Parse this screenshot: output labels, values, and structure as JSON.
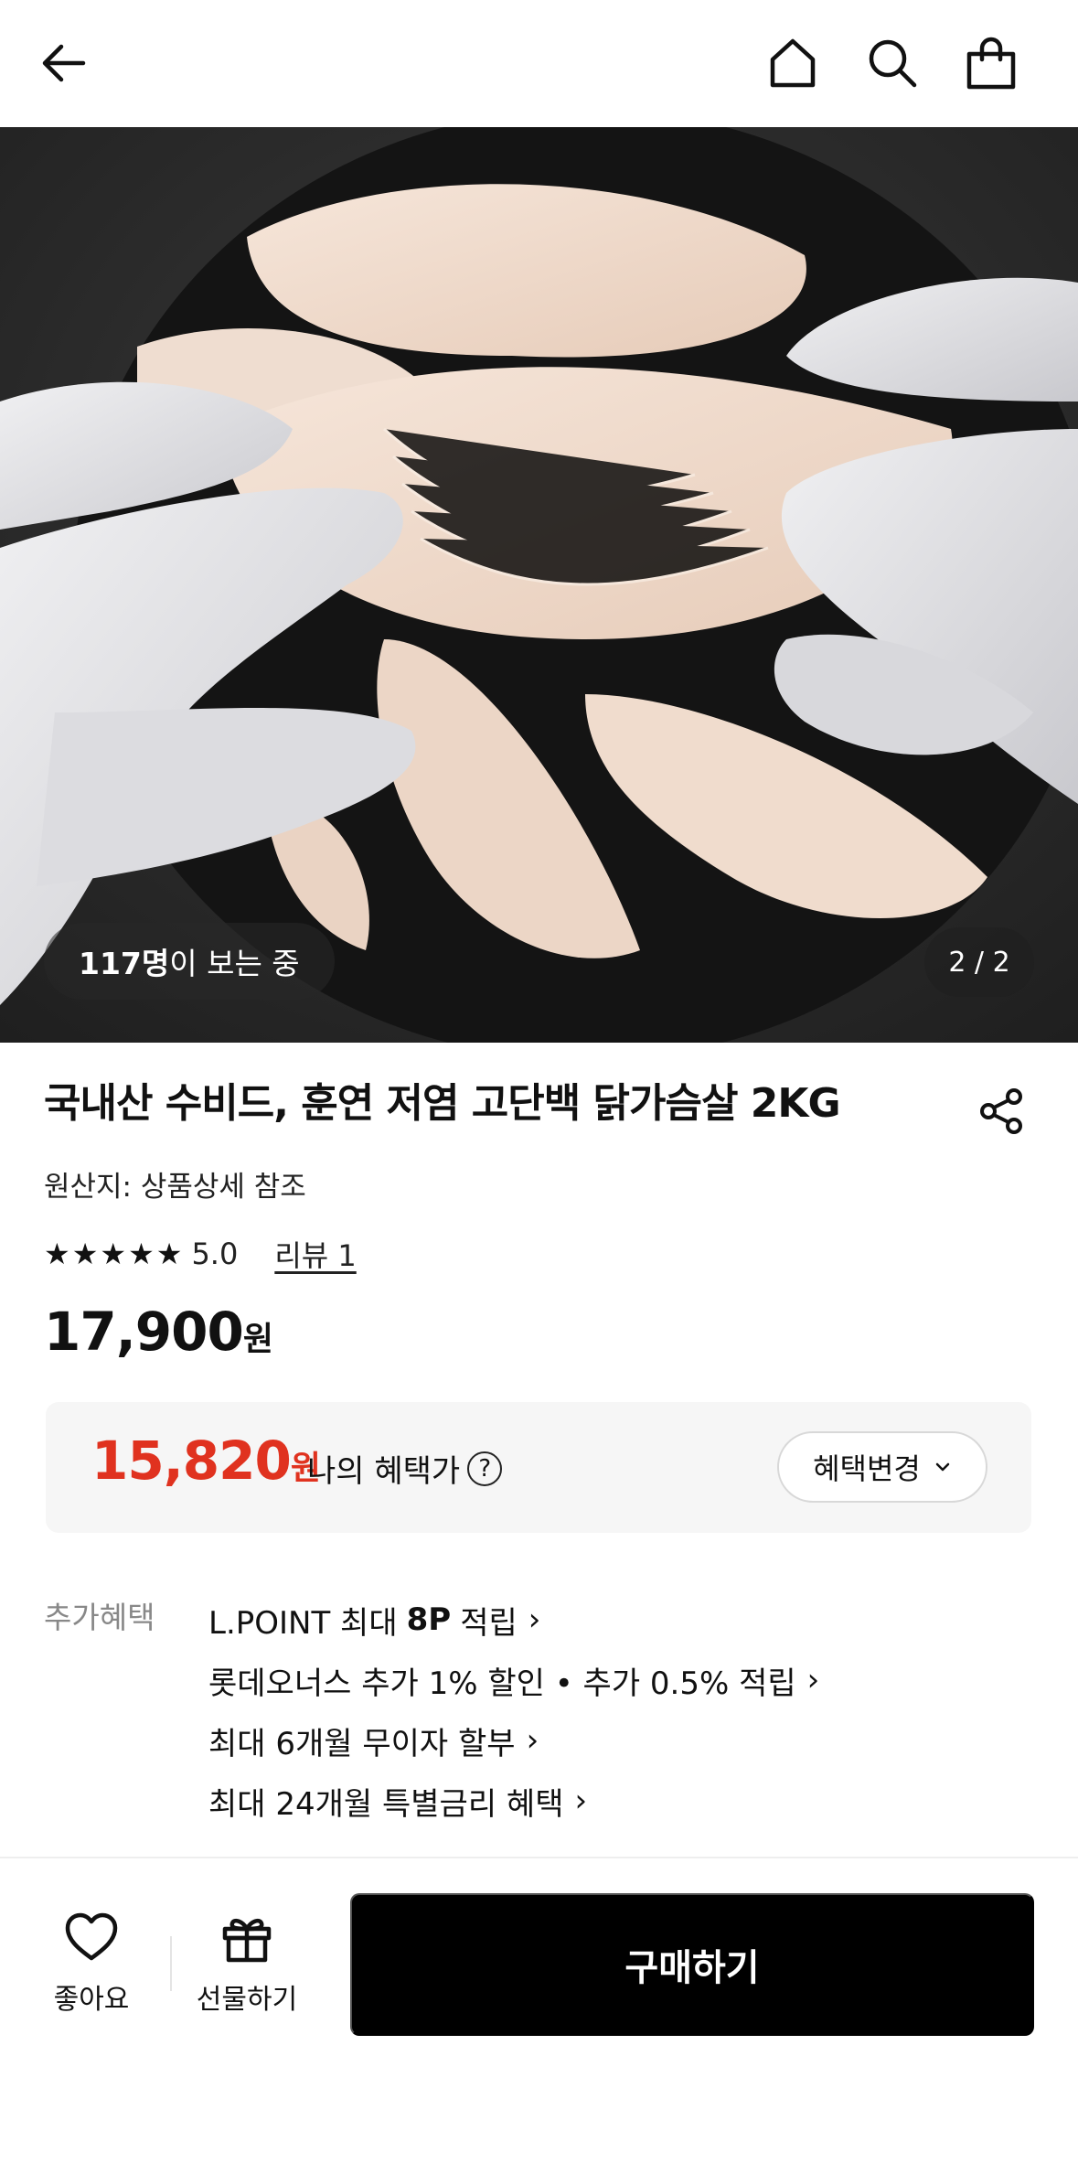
{
  "header": {
    "back_icon": "arrow-left-icon",
    "home_icon": "home-icon",
    "search_icon": "search-icon",
    "cart_icon": "shopping-bag-icon"
  },
  "hero": {
    "viewers_count": "117명",
    "viewers_suffix": "이 보는 중",
    "pager": "2 / 2"
  },
  "product": {
    "title": "국내산 수비드, 훈연 저염 고단백 닭가슴살 2KG",
    "origin": "원산지: 상품상세 참조",
    "rating": 5.0,
    "rating_text": "5.0",
    "review_link": "리뷰 1",
    "price": "17,900",
    "price_unit": "원"
  },
  "benefit": {
    "price": "15,820",
    "price_unit": "원",
    "label": "나의 혜택가",
    "help_icon": "?",
    "change_label": "혜택변경",
    "accent_color": "#e0321f"
  },
  "extra": {
    "label": "추가혜택",
    "items": [
      {
        "text": "L.POINT 최대",
        "bold": "8P",
        "after": "적립"
      },
      {
        "text": "롯데오너스 추가 1% 할인 • 추가 0.5% 적립"
      },
      {
        "text": "최대 6개월 무이자 할부"
      },
      {
        "text": "최대 24개월 특별금리 혜택"
      }
    ]
  },
  "bottom": {
    "like_label": "좋아요",
    "gift_label": "선물하기",
    "buy_label": "구매하기"
  }
}
